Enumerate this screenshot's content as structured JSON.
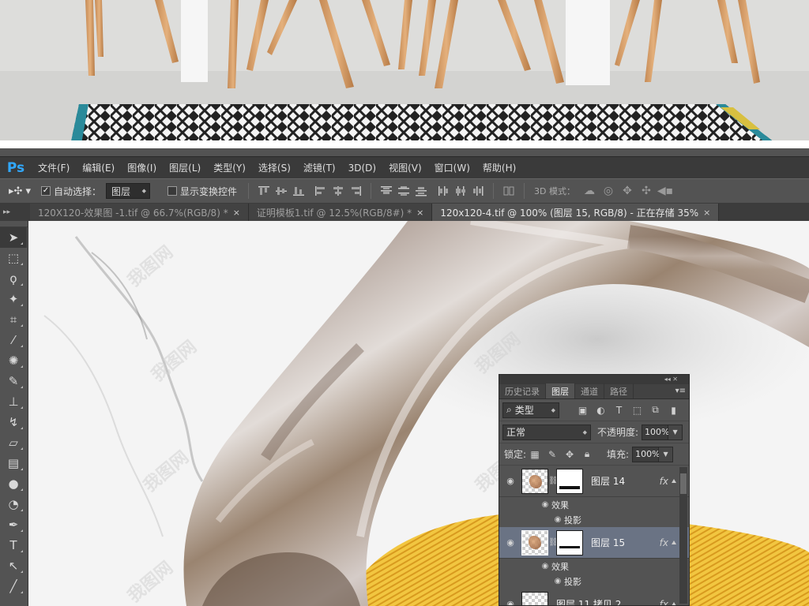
{
  "app": {
    "logo": "Ps"
  },
  "menu": [
    "文件(F)",
    "编辑(E)",
    "图像(I)",
    "图层(L)",
    "类型(Y)",
    "选择(S)",
    "滤镜(T)",
    "3D(D)",
    "视图(V)",
    "窗口(W)",
    "帮助(H)"
  ],
  "options": {
    "auto_select_label": "自动选择：",
    "auto_select_value": "图层",
    "show_transform_label": "显示变换控件",
    "mode_3d_label": "3D 模式："
  },
  "tabs": [
    {
      "label": "120X120-效果图 -1.tif @ 66.7%(RGB/8) *",
      "close": "×"
    },
    {
      "label": "证明模板1.tif @ 12.5%(RGB/8#) *",
      "close": "×"
    },
    {
      "label": "120x120-4.tif @ 100% (图层 15, RGB/8) - 正在存储 35%",
      "close": "×"
    }
  ],
  "watermark": "我图网",
  "layers_panel": {
    "tabs": [
      "历史记录",
      "图层",
      "通道",
      "路径"
    ],
    "kind": "类型",
    "blend_mode": "正常",
    "opacity_label": "不透明度:",
    "opacity_value": "100%",
    "lock_label": "锁定:",
    "fill_label": "填充:",
    "fill_value": "100%",
    "layers": [
      {
        "name": "图层 14",
        "effects_label": "效果",
        "effect": "投影"
      },
      {
        "name": "图层 15",
        "effects_label": "效果",
        "effect": "投影"
      },
      {
        "name": "图层 11 拷贝 2"
      }
    ],
    "fx": "fx"
  },
  "colors": {
    "accent": "#31a8ff",
    "selected_layer": "#6a7384"
  }
}
